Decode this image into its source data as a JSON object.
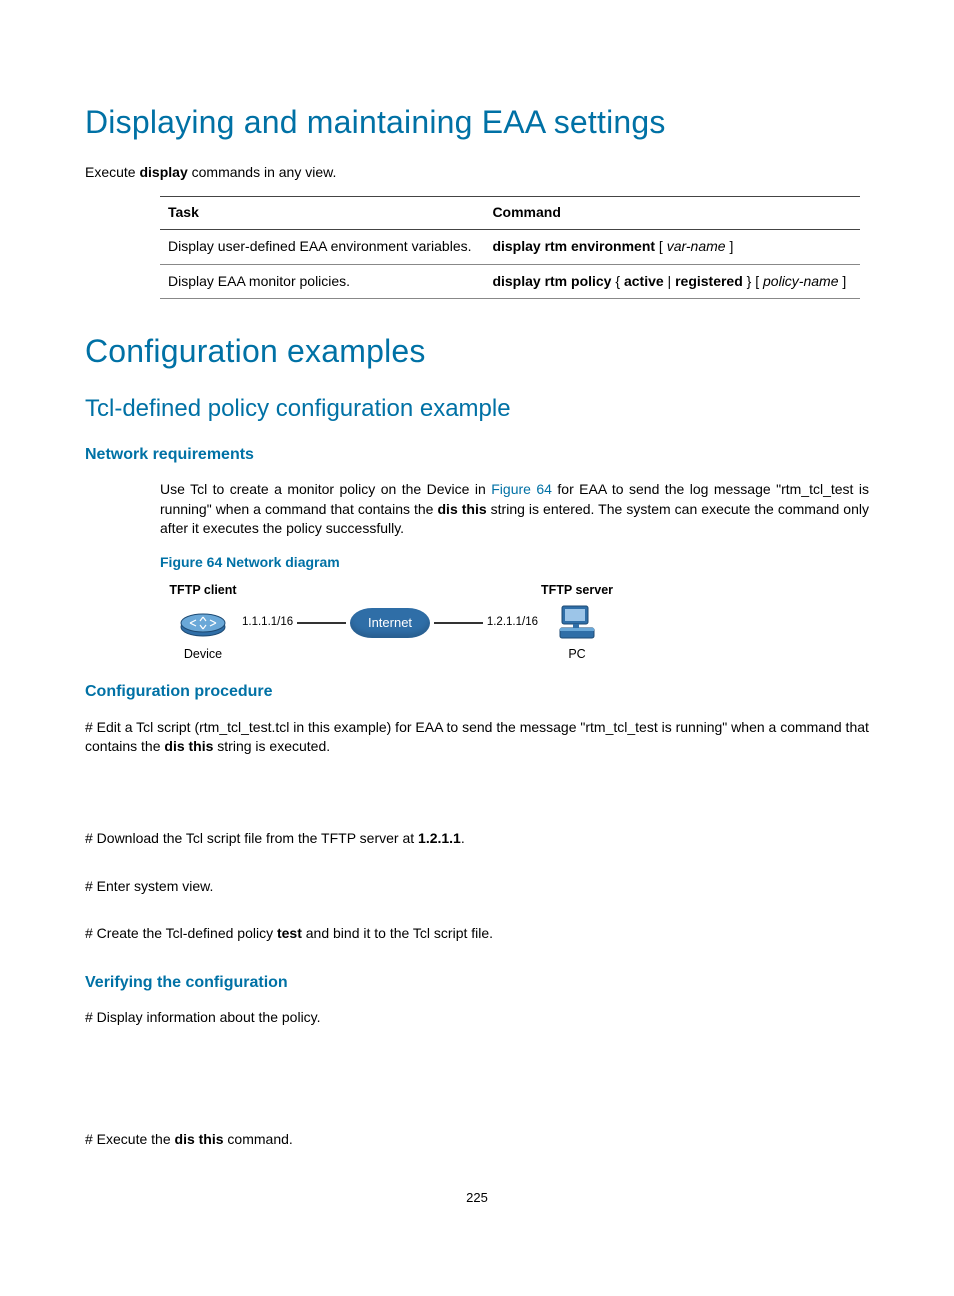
{
  "h1_1": "Displaying and maintaining EAA settings",
  "intro1_pre": "Execute ",
  "intro1_bold": "display",
  "intro1_post": " commands in any view.",
  "table": {
    "th_task": "Task",
    "th_cmd": "Command",
    "r1_task": "Display user-defined EAA environment variables.",
    "r1_cmd_b1": "display rtm environment",
    "r1_cmd_t1": " [ ",
    "r1_cmd_i1": "var-name",
    "r1_cmd_t2": " ]",
    "r2_task": "Display EAA monitor policies.",
    "r2_cmd_b1": "display rtm policy",
    "r2_cmd_t1": " { ",
    "r2_cmd_b2": "active",
    "r2_cmd_t2": " | ",
    "r2_cmd_b3": "registered",
    "r2_cmd_t3": " } [ ",
    "r2_cmd_i1": "policy-name",
    "r2_cmd_t4": " ]"
  },
  "h1_2": "Configuration examples",
  "h2_1": "Tcl-defined policy configuration example",
  "h3_1": "Network requirements",
  "netreq_1": "Use Tcl to create a monitor policy on the Device in ",
  "netreq_link": "Figure 64",
  "netreq_2": " for EAA to send the log message \"rtm_tcl_test is running\" when a command that contains the ",
  "netreq_bold": "dis this",
  "netreq_3": " string is entered. The system can execute the command only after it executes the policy successfully.",
  "figcap": "Figure 64 Network diagram",
  "diagram": {
    "client_label": "TFTP client",
    "server_label": "TFTP server",
    "left_ip": "1.1.1.1/16",
    "right_ip": "1.2.1.1/16",
    "cloud": "Internet",
    "device": "Device",
    "pc": "PC"
  },
  "h3_2": "Configuration procedure",
  "proc1_a": "# Edit a Tcl script (rtm_tcl_test.tcl in this example) for EAA to send the message \"rtm_tcl_test is running\" when a command that contains the ",
  "proc1_bold": "dis this",
  "proc1_b": " string is executed.",
  "proc2_a": "# Download the Tcl script file from the TFTP server at ",
  "proc2_bold": "1.2.1.1",
  "proc2_b": ".",
  "proc3": "# Enter system view.",
  "proc4_a": "# Create the Tcl-defined policy ",
  "proc4_bold": "test",
  "proc4_b": " and bind it to the Tcl script file.",
  "h3_3": "Verifying the configuration",
  "verify1": "# Display information about the policy.",
  "verify2_a": "# Execute the ",
  "verify2_bold": "dis this",
  "verify2_b": " command.",
  "page_no": "225"
}
